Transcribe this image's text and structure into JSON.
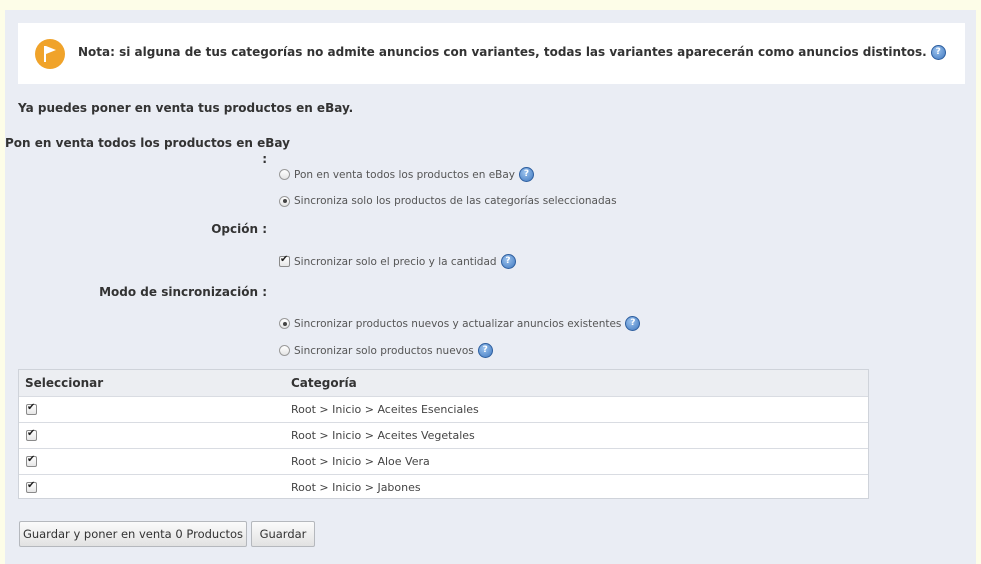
{
  "note": {
    "text": "Nota: si alguna de tus categorías no admite anuncios con variantes, todas las variantes aparecerán como anuncios distintos."
  },
  "intro": "Ya puedes poner en venta tus productos en eBay.",
  "section_all": {
    "label_line1": "Pon en venta todos los productos en eBay",
    "label_line2": ":",
    "options": [
      {
        "label": "Pon en venta todos los productos en eBay",
        "selected": false
      },
      {
        "label": "Sincroniza solo los productos de las categorías seleccionadas",
        "selected": true
      }
    ]
  },
  "section_option": {
    "label": "Opción :",
    "checkbox_label": "Sincronizar solo el precio y la cantidad",
    "checked": true
  },
  "section_mode": {
    "label": "Modo de sincronización :",
    "options": [
      {
        "label": "Sincronizar productos nuevos y actualizar anuncios existentes",
        "selected": true
      },
      {
        "label": "Sincronizar solo productos nuevos",
        "selected": false
      }
    ]
  },
  "table": {
    "headers": [
      "Seleccionar",
      "Categoría"
    ],
    "rows": [
      {
        "checked": true,
        "category": "Root > Inicio > Aceites Esenciales"
      },
      {
        "checked": true,
        "category": "Root > Inicio > Aceites Vegetales"
      },
      {
        "checked": true,
        "category": "Root > Inicio > Aloe Vera"
      },
      {
        "checked": true,
        "category": "Root > Inicio > Jabones"
      }
    ]
  },
  "buttons": {
    "save_and_list": "Guardar y poner en venta 0 Productos",
    "save": "Guardar"
  },
  "colors": {
    "note_icon": "#f0a32a",
    "panel_bg": "#eaedf4",
    "page_bg": "#fdfde8"
  }
}
